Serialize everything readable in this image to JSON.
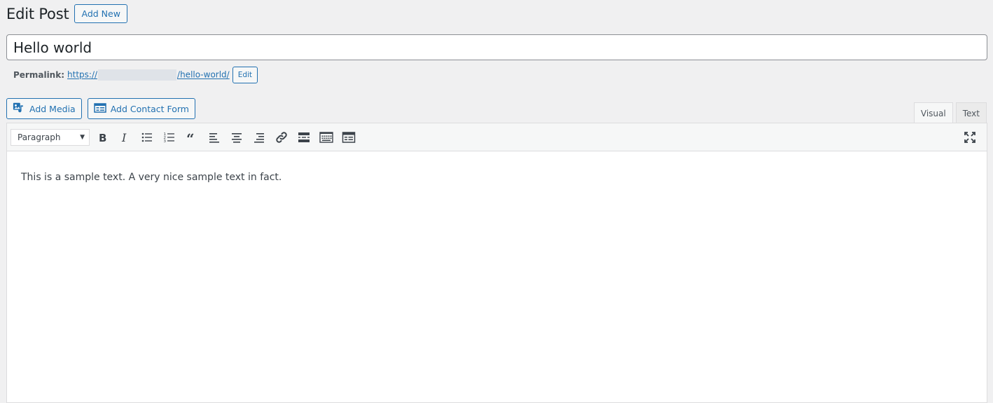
{
  "header": {
    "title": "Edit Post",
    "add_new_label": "Add New"
  },
  "post": {
    "title": "Hello world"
  },
  "permalink": {
    "label": "Permalink:",
    "url_prefix": "https://",
    "url_suffix": "/hello-world/",
    "edit_label": "Edit"
  },
  "media_buttons": {
    "add_media": "Add Media",
    "add_contact_form": "Add Contact Form"
  },
  "editor_tabs": {
    "visual": "Visual",
    "text": "Text",
    "active": "visual"
  },
  "toolbar": {
    "format": "Paragraph",
    "buttons": [
      "bold-icon",
      "italic-icon",
      "bullet-list-icon",
      "numbered-list-icon",
      "blockquote-icon",
      "align-left-icon",
      "align-center-icon",
      "align-right-icon",
      "link-icon",
      "read-more-icon",
      "toolbar-toggle-icon",
      "contact-form-icon",
      "fullscreen-icon"
    ]
  },
  "content": {
    "text": "This is a sample text. A very nice sample text in fact."
  },
  "colors": {
    "accent": "#2271b1",
    "background": "#f0f0f1",
    "text": "#1d2327"
  }
}
